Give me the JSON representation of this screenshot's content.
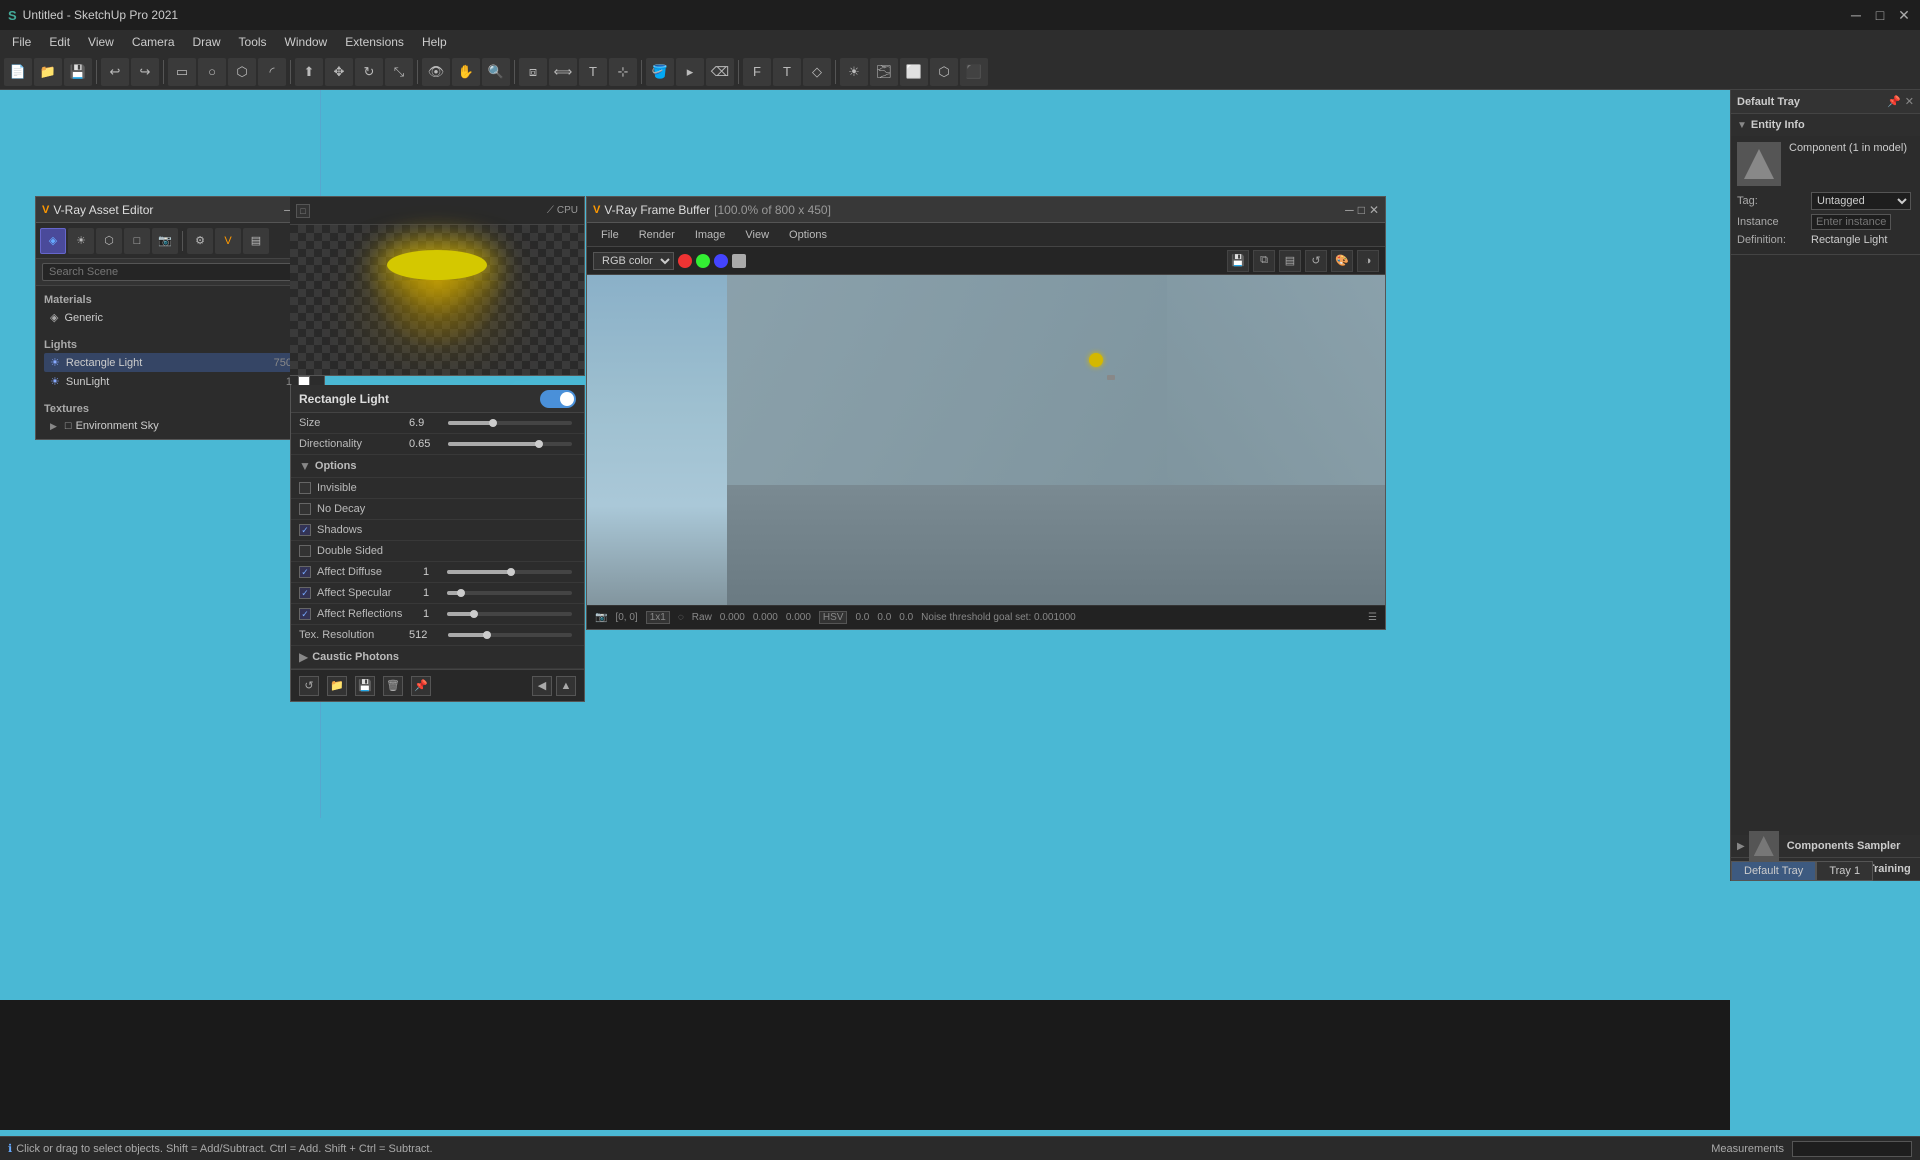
{
  "app": {
    "title": "Untitled - SketchUp Pro 2021",
    "window_buttons": [
      "─",
      "□",
      "✕"
    ]
  },
  "menu": {
    "items": [
      "File",
      "Edit",
      "View",
      "Camera",
      "Draw",
      "Tools",
      "Window",
      "Extensions",
      "Help"
    ]
  },
  "asset_editor": {
    "title": "V-Ray Asset Editor",
    "icon": "V",
    "sections": {
      "materials": {
        "title": "Materials",
        "items": [
          {
            "name": "Generic",
            "count": "",
            "color": ""
          }
        ]
      },
      "lights": {
        "title": "Lights",
        "items": [
          {
            "name": "Rectangle Light",
            "count": "750",
            "color": "#e6cc00"
          },
          {
            "name": "SunLight",
            "count": "1",
            "color": "#ffffff"
          }
        ]
      },
      "textures": {
        "title": "Textures",
        "items": [
          {
            "name": "Environment Sky",
            "count": "",
            "color": ""
          }
        ]
      }
    },
    "search_placeholder": "Search Scene"
  },
  "light_properties": {
    "title": "Rectangle Light",
    "toggle": true,
    "size": {
      "label": "Size",
      "value": "6.9",
      "fill_pct": 35
    },
    "directionality": {
      "label": "Directionality",
      "value": "0.65",
      "fill_pct": 72
    },
    "options_section": "Options",
    "invisible": {
      "label": "Invisible",
      "checked": false
    },
    "no_decay": {
      "label": "No Decay",
      "checked": false
    },
    "shadows": {
      "label": "Shadows",
      "checked": true
    },
    "double_sided": {
      "label": "Double Sided",
      "checked": false
    },
    "affect_diffuse": {
      "label": "Affect Diffuse",
      "checked": true,
      "value": "1",
      "fill_pct": 50
    },
    "affect_specular": {
      "label": "Affect Specular",
      "checked": true,
      "value": "1",
      "fill_pct": 10
    },
    "affect_reflections": {
      "label": "Affect Reflections",
      "checked": true,
      "value": "1",
      "fill_pct": 20
    },
    "tex_resolution": {
      "label": "Tex. Resolution",
      "value": "512",
      "fill_pct": 30
    },
    "caustic_photons": "Caustic Photons"
  },
  "vfb": {
    "title": "V-Ray Frame Buffer",
    "subtitle": "[100.0% of 800 x 450]",
    "menu": [
      "File",
      "Render",
      "Image",
      "View",
      "Options"
    ],
    "color_mode": "RGB color",
    "status": {
      "coords": "[0, 0]",
      "scale": "1x1",
      "mode": "Raw",
      "r": "0.000",
      "g": "0.000",
      "b": "0.000",
      "color_space": "HSV",
      "h": "0.0",
      "s": "0.0",
      "v": "0.0",
      "noise_info": "Noise threshold goal set: 0.001000"
    }
  },
  "right_panel": {
    "title": "Default Tray",
    "entity_info": {
      "title": "Entity Info",
      "component": "Component (1 in model)",
      "tag_label": "Tag:",
      "tag_value": "Untagged",
      "instance_placeholder": "Enter instance name",
      "definition_label": "Definition:",
      "definition_value": "Rectangle Light"
    },
    "components_sampler": {
      "title": "Components Sampler"
    },
    "dynamic_components": {
      "title": "Dynamic Components Training"
    },
    "tabs": {
      "default_tray": "Default Tray",
      "tray1": "Tray 1"
    }
  },
  "status_bar": {
    "message": "Click or drag to select objects. Shift = Add/Subtract. Ctrl = Add. Shift + Ctrl = Subtract.",
    "measurements_label": "Measurements"
  },
  "cpu": {
    "label": "CPU"
  }
}
